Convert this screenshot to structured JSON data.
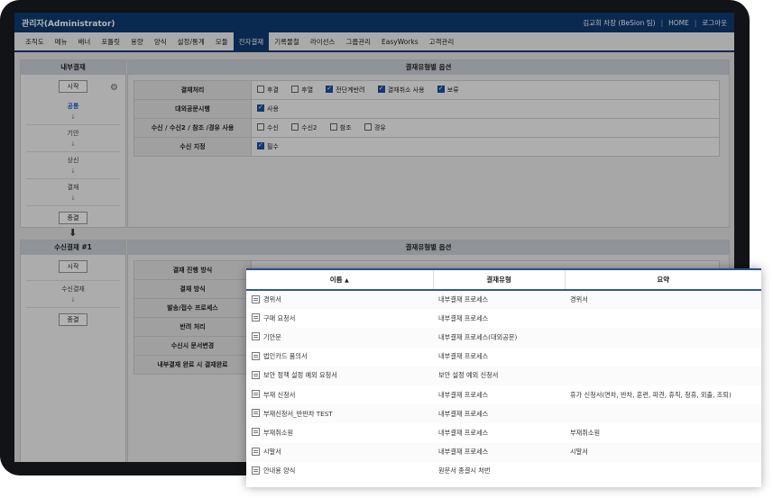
{
  "app": {
    "title": "관리자(Administrator)",
    "user": "김교회 차장 (BeSion 팀)",
    "home": "HOME",
    "logout": "로그아웃"
  },
  "tabs": [
    "조직도",
    "메뉴",
    "배너",
    "포틀릿",
    "용량",
    "양식",
    "설정/통계",
    "모듈",
    "전자결재",
    "기록물철",
    "라이선스",
    "그룹관리",
    "EasyWorks",
    "고객관리"
  ],
  "active_tab": "전자결재",
  "section1": {
    "left_header": "내부결재",
    "right_header": "결재유형별 옵션",
    "start": "시작",
    "steps": [
      "공통",
      "기안",
      "상신",
      "결재"
    ],
    "end": "종결",
    "rows": [
      {
        "label": "결재처리",
        "options": [
          {
            "text": "후결",
            "checked": false
          },
          {
            "text": "후열",
            "checked": false
          },
          {
            "text": "전단계반려",
            "checked": true
          },
          {
            "text": "결재취소 사용",
            "checked": true
          },
          {
            "text": "보류",
            "checked": true
          }
        ]
      },
      {
        "label": "대외공문시행",
        "options": [
          {
            "text": "사용",
            "checked": true
          }
        ]
      },
      {
        "label": "수신 / 수신2 / 참조 /경유 사용",
        "options": [
          {
            "text": "수신",
            "checked": false
          },
          {
            "text": "수신2",
            "checked": false
          },
          {
            "text": "참조",
            "checked": false
          },
          {
            "text": "경유",
            "checked": false
          }
        ]
      },
      {
        "label": "수신 지정",
        "options": [
          {
            "text": "필수",
            "checked": true
          }
        ]
      }
    ]
  },
  "section2": {
    "left_header": "수신결재 #1",
    "right_header": "결재유형별 옵션",
    "start": "시작",
    "step": "수신결재",
    "end": "종결",
    "rows": [
      "결재 진행 방식",
      "결재 방식",
      "발송/접수 프로세스",
      "반려 처리",
      "수신시 문서변경",
      "내부결재 완료 시 결재완료"
    ]
  },
  "popup": {
    "headers": [
      "이름",
      "결재유형",
      "요약"
    ],
    "sort_indicator": "▲",
    "rows": [
      {
        "name": "경위서",
        "type": "내부결재 프로세스",
        "summary": "경위서"
      },
      {
        "name": "구매 요청서",
        "type": "내부결재 프로세스",
        "summary": ""
      },
      {
        "name": "기안문",
        "type": "내부결재 프로세스(대외공문)",
        "summary": ""
      },
      {
        "name": "법인카드 품의서",
        "type": "내부결재 프로세스",
        "summary": ""
      },
      {
        "name": "보안 정책 설정 예외 요청서",
        "type": "보안 설정 예외 신청서",
        "summary": ""
      },
      {
        "name": "부재 신청서",
        "type": "내부결재 프로세스",
        "summary": "휴가 신청서(연차, 반차, 훈련, 파견, 휴직, 청휴, 외출, 조퇴)"
      },
      {
        "name": "부재신청서_반반차 TEST",
        "type": "내부결재 프로세스",
        "summary": ""
      },
      {
        "name": "부재취소원",
        "type": "내부결재 프로세스",
        "summary": "부재취소원"
      },
      {
        "name": "시말서",
        "type": "내부결재 프로세스",
        "summary": "시말서"
      },
      {
        "name": "안내용 양식",
        "type": "원문서 종결시 처번",
        "summary": ""
      }
    ]
  }
}
